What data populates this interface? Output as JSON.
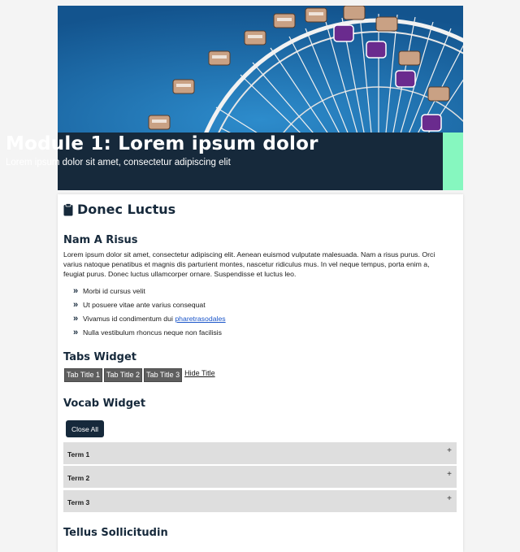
{
  "hero": {
    "title": "Module 1: Lorem ipsum dolor",
    "subtitle": "Lorem ipsum dolor sit amet, consectetur adipiscing elit",
    "image_icon": "ferris-wheel-photo",
    "accent_color": "#86f7bf",
    "banner_color": "#16293b"
  },
  "section": {
    "icon": "clipboard-icon",
    "title": "Donec Luctus"
  },
  "nam_a_risus": {
    "heading": "Nam A Risus",
    "paragraph": "Lorem ipsum dolor sit amet, consectetur adipiscing elit. Aenean euismod vulputate malesuada. Nam a risus purus. Orci varius natoque penatibus et magnis dis parturient montes, nascetur ridiculus mus. In vel neque tempus, porta enim a, feugiat purus. Donec luctus ullamcorper ornare. Suspendisse et luctus leo.",
    "bullets": [
      {
        "text": "Morbi id cursus velit"
      },
      {
        "text": "Ut posuere vitae ante varius consequat"
      },
      {
        "text": "Vivamus id condimentum dui ",
        "link": "pharetrasodales"
      },
      {
        "text": "Nulla vestibulum rhoncus neque non facilisis"
      }
    ]
  },
  "tabs_widget": {
    "heading": "Tabs Widget",
    "tabs": [
      "Tab Title 1",
      "Tab Title 2",
      "Tab Title 3"
    ],
    "hide_title": "Hide Title"
  },
  "vocab_widget": {
    "heading": "Vocab Widget",
    "close_all": "Close All",
    "terms": [
      "Term 1",
      "Term 2",
      "Term 3"
    ]
  },
  "tellus": {
    "heading": "Tellus Sollicitudin"
  }
}
